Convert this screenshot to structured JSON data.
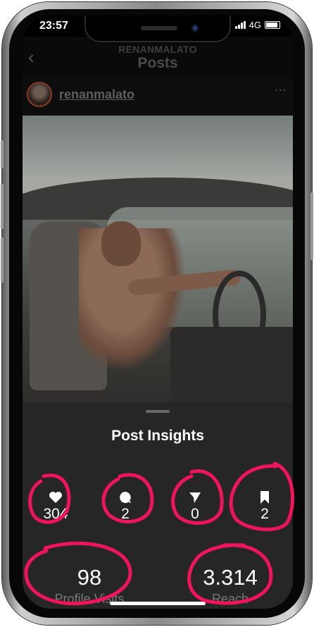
{
  "status_bar": {
    "time": "23:57",
    "network": "4G"
  },
  "header": {
    "username": "RENANMALATO",
    "title": "Posts"
  },
  "post": {
    "author": "renanmalato"
  },
  "insights": {
    "title": "Post Insights",
    "likes": "304",
    "comments": "2",
    "shares": "0",
    "saves": "2",
    "profile_visits": {
      "value": "98",
      "label": "Profile Visits"
    },
    "reach": {
      "value": "3.314",
      "label": "Reach"
    }
  },
  "colors": {
    "annotation": "#f0155a",
    "sheet_bg": "#262626"
  }
}
